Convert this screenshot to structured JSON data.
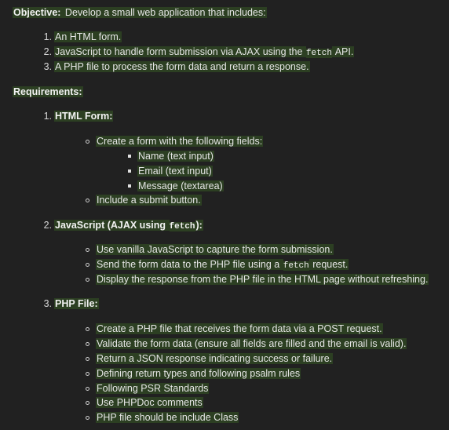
{
  "objective": {
    "label": "Objective:",
    "text": " Develop a small web application that includes:",
    "items": [
      "An HTML form.",
      "JavaScript to handle form submission via AJAX using the ",
      "A PHP file to process the form data and return a response."
    ],
    "item2_code": "fetch",
    "item2_tail": " API."
  },
  "requirements": {
    "label": "Requirements:",
    "sections": [
      {
        "number": "1.",
        "title": "HTML Form:",
        "bullets": [
          "Create a form with the following fields:",
          "Include a submit button."
        ],
        "fields": [
          "Name (text input)",
          "Email (text input)",
          "Message (textarea)"
        ]
      },
      {
        "number": "2.",
        "title_pre": "JavaScript (AJAX using ",
        "title_code": "fetch",
        "title_post": "):",
        "bullets": [
          "Use vanilla JavaScript to capture the form submission.",
          "Send the form data to the PHP file using a ",
          "Display the response from the PHP file in the HTML page without refreshing."
        ],
        "bullet2_code": "fetch",
        "bullet2_tail": " request."
      },
      {
        "number": "3.",
        "title": "PHP File:",
        "bullets": [
          "Create a PHP file that receives the form data via a POST request.",
          "Validate the form data (ensure all fields are filled and the email is valid).",
          "Return a JSON response indicating success or failure.",
          "Defining return types and following psalm rules",
          "Following PSR Standards",
          "Use PHPDoc comments",
          "PHP file should be include Class"
        ]
      }
    ]
  },
  "obj_numbers": [
    "1.",
    "2.",
    "3."
  ]
}
